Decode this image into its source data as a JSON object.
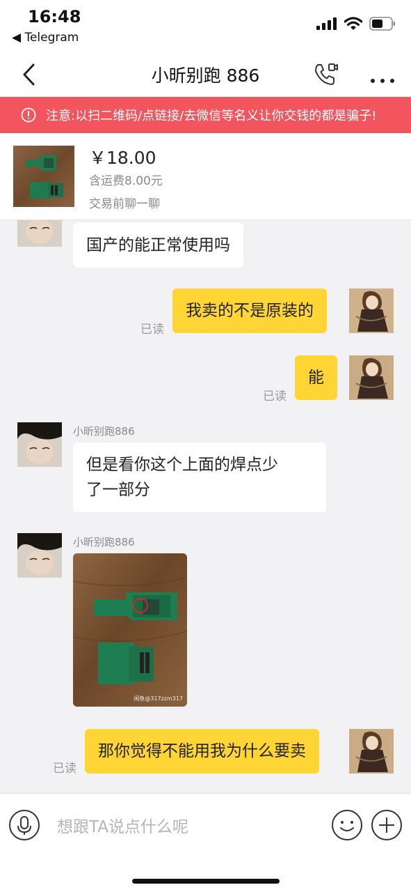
{
  "status_bar": {
    "time": "16:48",
    "back_app": "◀ Telegram"
  },
  "nav": {
    "title": "小昕别跑 886"
  },
  "warning": {
    "text": "注意:以扫二维码/点链接/去微信等名义让你交钱的都是骗子!"
  },
  "product": {
    "price": "￥18.00",
    "shipping": "含运费8.00元",
    "note": "交易前聊一聊"
  },
  "messages": [
    {
      "dir": "in",
      "text": "国产的能正常使用吗"
    },
    {
      "dir": "out",
      "text": "我卖的不是原装的",
      "status": "已读"
    },
    {
      "dir": "out",
      "text": "能",
      "status": "已读"
    },
    {
      "dir": "in",
      "sender": "小昕别跑886",
      "line1": "但是看你这个上面的焊点少",
      "line2": "了一部分"
    },
    {
      "dir": "in",
      "sender": "小昕别跑886",
      "type": "image",
      "watermark": "闲鱼@317zzm317"
    },
    {
      "dir": "out",
      "text": "那你觉得不能用我为什么要卖",
      "status": "已读"
    }
  ],
  "input": {
    "placeholder": "想跟TA说点什么呢"
  },
  "colors": {
    "warning_bg": "#f2555d",
    "outgoing_bubble": "#ffd535",
    "incoming_bubble": "#ffffff",
    "chat_bg": "#f2f2f4"
  },
  "icons": [
    "back-chevron-icon",
    "video-call-icon",
    "more-icon",
    "warning-icon",
    "microphone-icon",
    "emoji-icon",
    "plus-icon",
    "signal-icon",
    "wifi-icon",
    "battery-icon"
  ]
}
